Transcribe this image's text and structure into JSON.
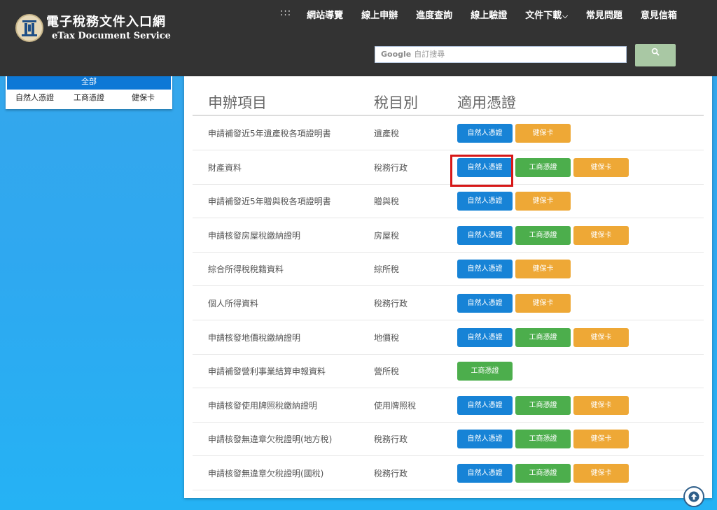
{
  "header": {
    "logo_zh": "電子稅務文件入口網",
    "logo_en": "eTax Document Service",
    "nav": [
      {
        "label": ":::"
      },
      {
        "label": "網站導覽"
      },
      {
        "label": "線上申辦"
      },
      {
        "label": "進度查詢"
      },
      {
        "label": "線上驗證"
      },
      {
        "label": "文件下載"
      },
      {
        "label": "常見問題"
      },
      {
        "label": "意見信箱"
      }
    ],
    "search": {
      "brand": "Google",
      "placeholder": "自訂搜尋",
      "button_icon": "search-icon"
    }
  },
  "filter": {
    "all_label": "全部",
    "options": [
      "自然人憑證",
      "工商憑證",
      "健保卡"
    ]
  },
  "table": {
    "headers": {
      "item": "申辦項目",
      "tax": "稅目別",
      "cert": "適用憑證"
    },
    "cert_labels": {
      "natural": "自然人憑證",
      "business": "工商憑證",
      "health": "健保卡"
    },
    "rows": [
      {
        "item": "申請補發近5年遺產稅各項證明書",
        "tax": "遺產稅",
        "certs": [
          "natural",
          "health"
        ]
      },
      {
        "item": "財產資料",
        "tax": "稅務行政",
        "certs": [
          "natural",
          "business",
          "health"
        ]
      },
      {
        "item": "申請補發近5年贈與稅各項證明書",
        "tax": "贈與稅",
        "certs": [
          "natural",
          "health"
        ]
      },
      {
        "item": "申請核發房屋稅繳納證明",
        "tax": "房屋稅",
        "certs": [
          "natural",
          "business",
          "health"
        ]
      },
      {
        "item": "綜合所得稅稅籍資料",
        "tax": "綜所稅",
        "certs": [
          "natural",
          "health"
        ]
      },
      {
        "item": "個人所得資料",
        "tax": "稅務行政",
        "certs": [
          "natural",
          "health"
        ]
      },
      {
        "item": "申請核發地價稅繳納證明",
        "tax": "地價稅",
        "certs": [
          "natural",
          "business",
          "health"
        ]
      },
      {
        "item": "申請補發營利事業結算申報資料",
        "tax": "營所稅",
        "certs": [
          "business"
        ]
      },
      {
        "item": "申請核發使用牌照稅繳納證明",
        "tax": "使用牌照稅",
        "certs": [
          "natural",
          "business",
          "health"
        ]
      },
      {
        "item": "申請核發無違章欠稅證明(地方稅)",
        "tax": "稅務行政",
        "certs": [
          "natural",
          "business",
          "health"
        ]
      },
      {
        "item": "申請核發無違章欠稅證明(國稅)",
        "tax": "稅務行政",
        "certs": [
          "natural",
          "business",
          "health"
        ]
      }
    ]
  },
  "colors": {
    "header_bg": "#333333",
    "natural": "#1783d6",
    "business": "#4cae4c",
    "health": "#eea836",
    "highlight": "#d71818"
  }
}
